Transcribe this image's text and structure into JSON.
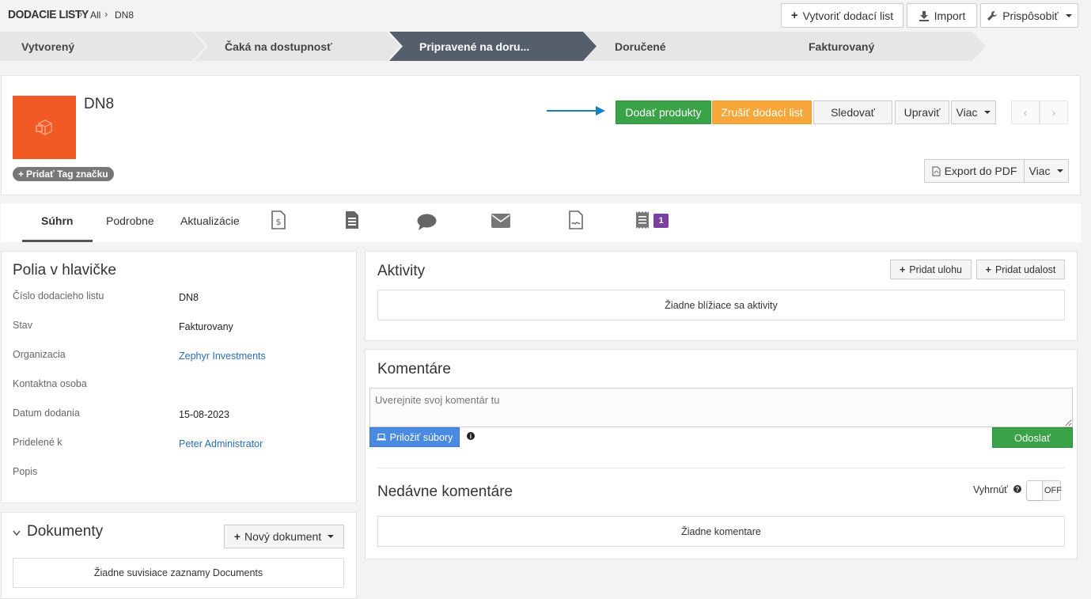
{
  "header": {
    "module_title": "DODACIE LISTY",
    "breadcrumb_all": "All",
    "breadcrumb_current": "DN8",
    "create_button": "Vytvoriť dodací list",
    "import_button": "Import",
    "customize_button": "Prispôsobiť"
  },
  "pipeline": [
    {
      "label": "Vytvorený"
    },
    {
      "label": "Čaká na dostupnosť"
    },
    {
      "label": "Pripravené na doru..."
    },
    {
      "label": "Doručené"
    },
    {
      "label": "Fakturovaný"
    }
  ],
  "record": {
    "title": "DN8",
    "add_tag": "Pridať Tag značku",
    "deliver_button": "Dodať produkty",
    "cancel_button": "Zrušiť dodací list",
    "follow_button": "Sledovať",
    "edit_button": "Upraviť",
    "more_button": "Viac",
    "export_pdf_button": "Export do PDF",
    "more_button_2": "Viac"
  },
  "tabs": {
    "summary": "Súhrn",
    "details": "Podrobne",
    "updates": "Aktualizácie",
    "badge_count": "1"
  },
  "header_fields": {
    "title": "Polia v hlavičke",
    "rows": [
      {
        "label": "Číslo dodacieho listu",
        "value": "DN8"
      },
      {
        "label": "Stav",
        "value": "Fakturovany"
      },
      {
        "label": "Organizacia",
        "value": "Zephyr Investments"
      },
      {
        "label": "Kontaktna osoba",
        "value": ""
      },
      {
        "label": "Datum dodania",
        "value": "15-08-2023"
      },
      {
        "label": "Pridelené k",
        "value": "Peter Administrator"
      },
      {
        "label": "Popis",
        "value": ""
      }
    ]
  },
  "documents": {
    "title": "Dokumenty",
    "new_button": "Nový dokument",
    "empty": "Žiadne suvisiace zaznamy Documents"
  },
  "activities": {
    "title": "Aktivity",
    "add_task": "Pridat ulohu",
    "add_event": "Pridat udalost",
    "empty": "Žiadne blížiace sa aktivity"
  },
  "comments": {
    "title": "Komentáre",
    "placeholder": "Uverejnite svoj komentár tu",
    "attach_button": "Priložiť súbory",
    "send_button": "Odoslať",
    "recent_title": "Nedávne komentáre",
    "collapse_label": "Vyhrnúť",
    "toggle_state": "OFF",
    "empty": "Žiadne komentare"
  },
  "colors": {
    "accent_orange": "#f15a24",
    "green": "#3aa348",
    "orange_button": "#f7a73a",
    "blue_button": "#4a8ae0",
    "pipeline_active": "#555f6b",
    "badge_purple": "#7b3fa0",
    "arrow_blue": "#1a7fc1"
  }
}
